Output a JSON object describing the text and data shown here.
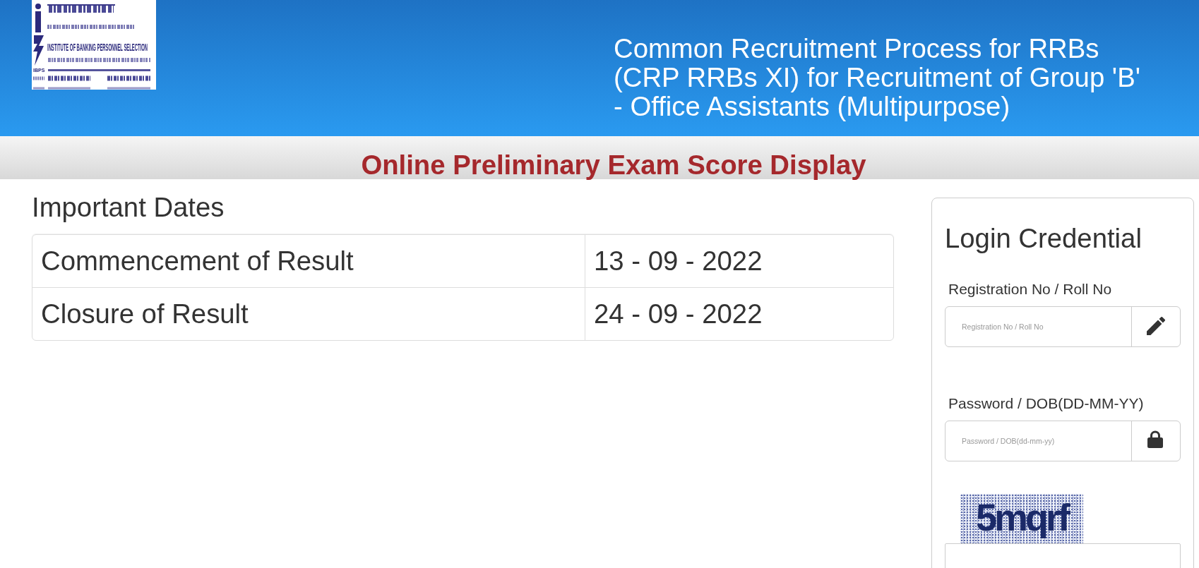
{
  "header": {
    "logo": {
      "abbreviation": "IBPS",
      "name": "INSTITUTE OF BANKING PERSONNEL SELECTION"
    },
    "title": "Common Recruitment Process for RRBs (CRP RRBs XI) for Recruitment of Group 'B' - Office Assistants (Multipurpose)"
  },
  "banner": {
    "title": "Online Preliminary Exam Score Display"
  },
  "important_dates": {
    "heading": "Important Dates",
    "rows": [
      {
        "event": "Commencement of Result",
        "date": "13 - 09 - 2022"
      },
      {
        "event": "Closure of Result",
        "date": "24 - 09 - 2022"
      }
    ]
  },
  "login": {
    "heading": "Login Credential",
    "fields": [
      {
        "kind": "text",
        "label": "Registration No / Roll No",
        "placeholder": "Registration No / Roll No"
      },
      {
        "kind": "password",
        "label": "Password / DOB(DD-MM-YY)",
        "placeholder": "Password / DOB(dd-mm-yy)"
      }
    ],
    "captcha": "5mqrf"
  }
}
